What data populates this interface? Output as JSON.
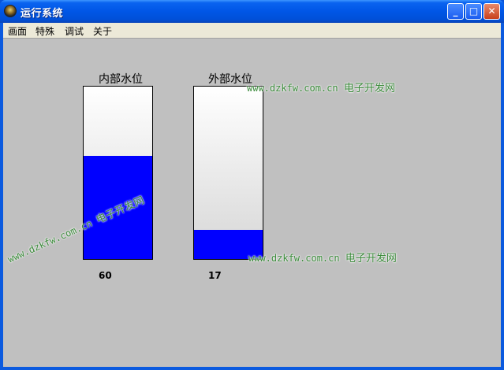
{
  "window": {
    "title": "运行系统"
  },
  "title_buttons": {
    "minimize": "_",
    "maximize": "□",
    "close": "✕"
  },
  "menu": [
    "画面",
    "特殊",
    "调试",
    "关于"
  ],
  "tanks": [
    {
      "label": "内部水位",
      "value": "60",
      "level": 0.6
    },
    {
      "label": "外部水位",
      "value": "17",
      "level": 0.17
    }
  ],
  "watermarks": [
    {
      "url": "www.dzkfw.com.cn",
      "site": "电子开发网"
    },
    {
      "url": "www.dzkfw.com.cn",
      "site": "电子开发网"
    },
    {
      "url": "www.dzkfw.com.cn",
      "site": "电子开发网"
    }
  ],
  "colors": {
    "fill": "#0000ff",
    "client_bg": "#c0c0c0",
    "titlebar": "#0056e6"
  }
}
